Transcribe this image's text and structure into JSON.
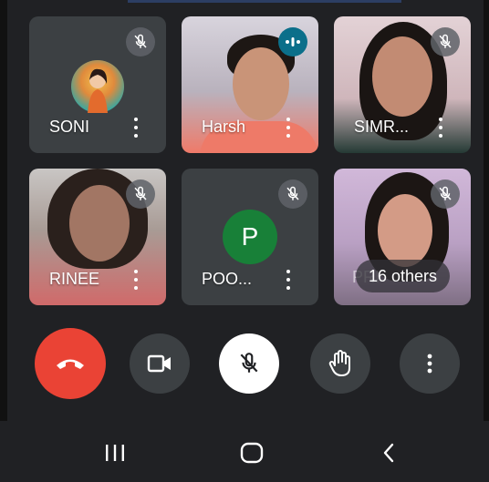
{
  "colors": {
    "background": "#202124",
    "tile": "#3c4043",
    "end_call": "#ea4335",
    "speaking": "#0b6f8a",
    "avatar_p": "#188038"
  },
  "participants": [
    {
      "name": "SONI",
      "muted": true,
      "type": "avatar-photo"
    },
    {
      "name": "Harsh",
      "muted": false,
      "speaking": true,
      "type": "video"
    },
    {
      "name": "SIMR...",
      "muted": true,
      "type": "video"
    },
    {
      "name": "RINEE",
      "muted": true,
      "type": "video"
    },
    {
      "name": "POO...",
      "muted": true,
      "type": "avatar-letter",
      "initial": "P"
    },
    {
      "name": "PRI",
      "muted": true,
      "type": "video"
    }
  ],
  "others_label": "16 others",
  "controls": {
    "end_call": "end-call-icon",
    "camera": "video-camera-icon",
    "mic": "mic-off-icon",
    "raise_hand": "hand-icon",
    "more": "more-vert-icon"
  },
  "navbar": {
    "recents": "recents-icon",
    "home": "home-icon",
    "back": "back-icon"
  }
}
